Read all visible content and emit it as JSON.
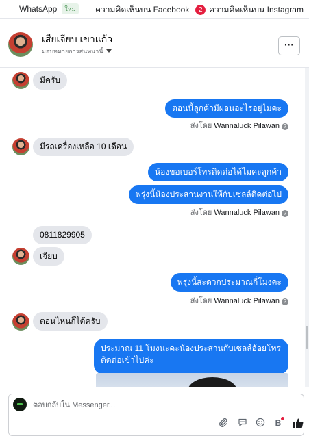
{
  "tabs": [
    {
      "label": "WhatsApp",
      "badge": "ใหม่"
    },
    {
      "label": "ความคิดเห็นบน Facebook",
      "count": "2"
    },
    {
      "label": "ความคิดเห็นบน Instagram"
    }
  ],
  "header": {
    "contact_name": "เสียเจียบ เขาแก้ว",
    "assign_label": "มอบหมายการสนทนานี้",
    "more_label": "···"
  },
  "messages": [
    {
      "dir": "in",
      "text": "มีครับ"
    },
    {
      "dir": "out",
      "text": "ตอนนี้ลูกค้ามีผ่อนอะไรอยู่ไมคะ"
    },
    {
      "sent_by_prefix": "ส่งโดย",
      "sender": "Wannaluck Pilawan"
    },
    {
      "dir": "in",
      "text": "มีรถเครื่องเหลือ 10 เดือน"
    },
    {
      "dir": "out",
      "text": "น้องขอเบอร์โทรติดต่อได้ไมคะลูกค้า"
    },
    {
      "dir": "out",
      "text": "พรุ่งนี้น้องประสานงานให้กับเซลล์ติดต่อไป"
    },
    {
      "sent_by_prefix": "ส่งโดย",
      "sender": "Wannaluck Pilawan"
    },
    {
      "dir": "in",
      "text": "0811829905"
    },
    {
      "dir": "in",
      "text": "เจียบ"
    },
    {
      "dir": "out",
      "text": "พรุ่งนี้สะดวกประมาณกี่โมงคะ"
    },
    {
      "sent_by_prefix": "ส่งโดย",
      "sender": "Wannaluck Pilawan"
    },
    {
      "dir": "in",
      "text": "ตอนไหนก็ได้ครับ"
    },
    {
      "dir": "out",
      "text_line1": "ประมาณ 11 โมงนะคะน้องประสานกับเซลล์อ้อยโทร",
      "text_line2": "ติดต่อเข้าไปค่ะ"
    }
  ],
  "composer": {
    "placeholder": "ตอบกลับใน Messenger..."
  },
  "icons": [
    "attach-icon",
    "chat-icon",
    "emoji-icon",
    "bold-icon",
    "like-icon",
    "more-icon",
    "info-icon"
  ],
  "colors": {
    "outgoing": "#1877f2",
    "incoming": "#e4e6eb",
    "badge_red": "#e41e3f"
  }
}
